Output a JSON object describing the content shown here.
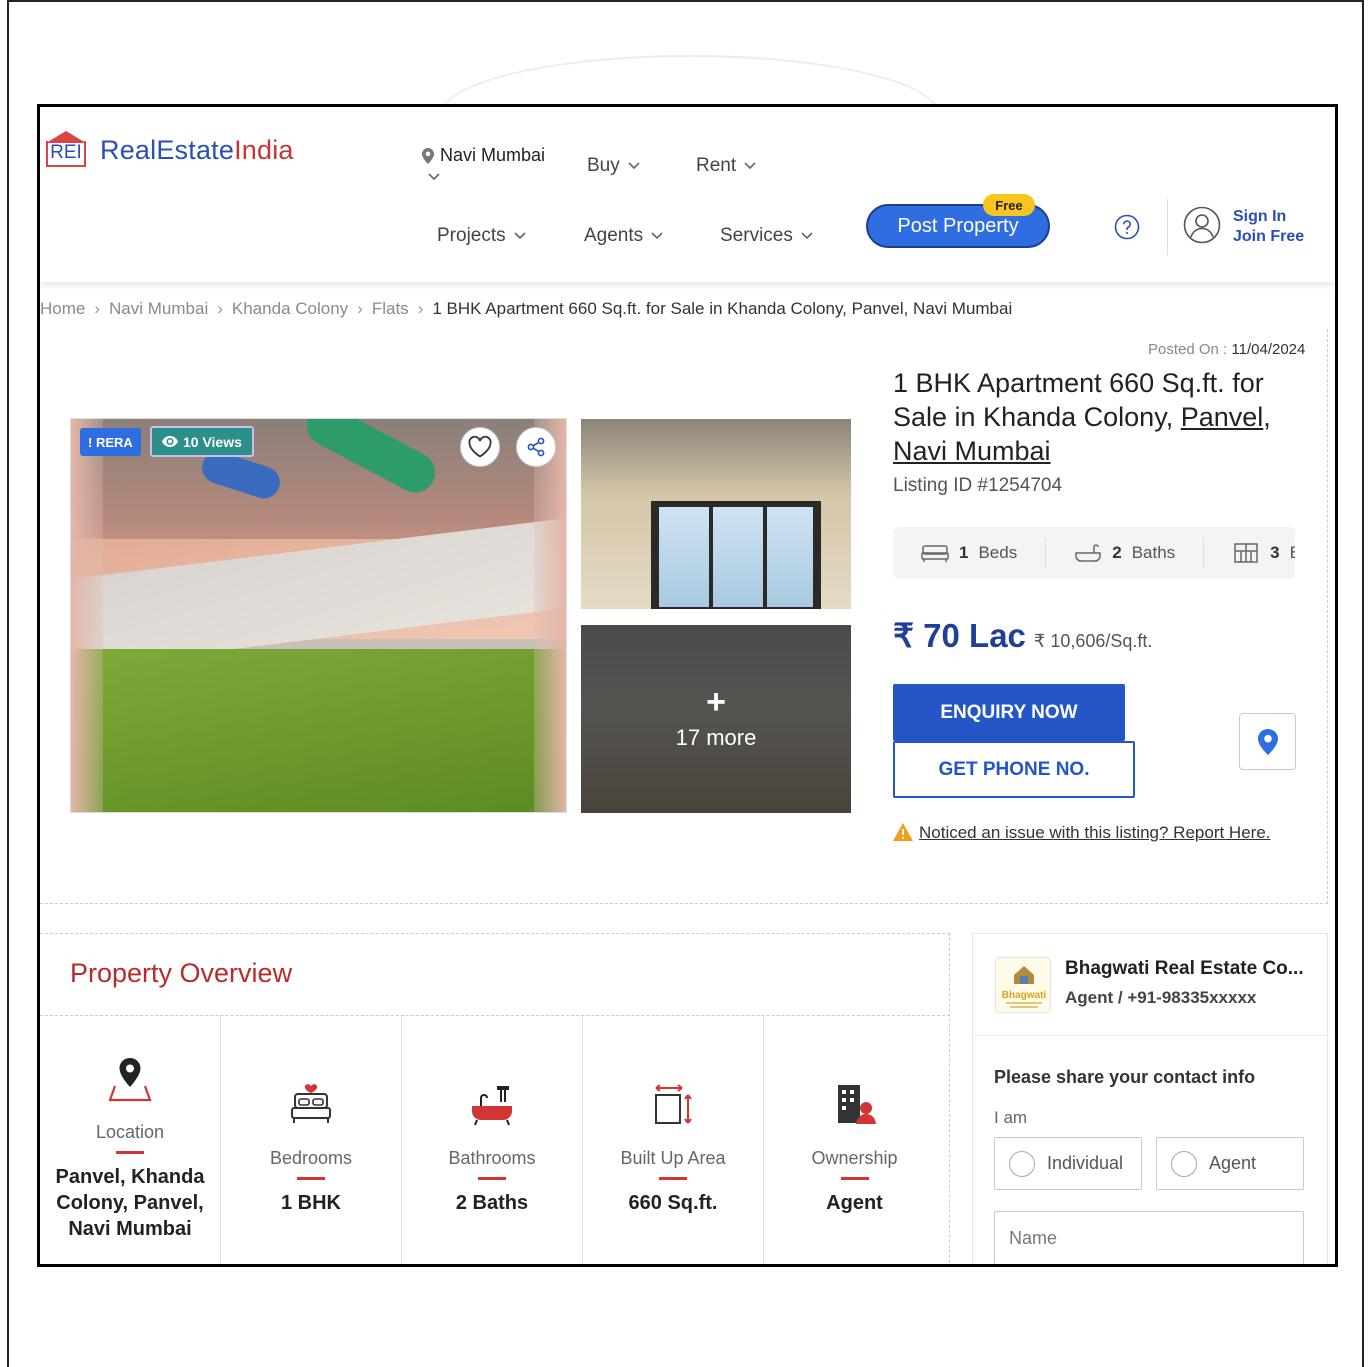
{
  "header": {
    "logo_letters": "REI",
    "logo_name_part1": "RealEstate",
    "logo_name_part2": "India",
    "location": "Navi Mumbai",
    "nav": {
      "buy": "Buy",
      "rent": "Rent",
      "projects": "Projects",
      "agents": "Agents",
      "services": "Services"
    },
    "post_property": "Post Property",
    "free_badge": "Free",
    "sign_in": "Sign In",
    "join_free": "Join Free"
  },
  "breadcrumb": {
    "items": [
      "Home",
      "Navi Mumbai",
      "Khanda Colony",
      "Flats"
    ],
    "current": "1 BHK Apartment 660 Sq.ft. for Sale in Khanda Colony, Panvel, Navi Mumbai"
  },
  "listing": {
    "posted_label": "Posted On :",
    "posted_date": "11/04/2024",
    "title_part1": "1 BHK Apartment 660 Sq.ft. for Sale in Khanda Colony, ",
    "title_link1": "Panvel",
    "title_comma": ",",
    "title_link2": "Navi Mumbai",
    "listing_id": "Listing ID #1254704",
    "rera_badge": "RERA",
    "views_badge": "10 Views",
    "more_photos": "17 more",
    "specs": [
      {
        "value": "1",
        "label": "Beds"
      },
      {
        "value": "2",
        "label": "Baths"
      },
      {
        "value": "3",
        "label": "Ba"
      }
    ],
    "price": "₹ 70 Lac",
    "price_per_sqft": "₹ 10,606/Sq.ft.",
    "enquiry_button": "ENQUIRY NOW",
    "phone_button": "GET PHONE NO.",
    "report_text": "Noticed an issue with this listing? Report Here."
  },
  "overview": {
    "title": "Property Overview",
    "items": [
      {
        "label": "Location",
        "value": "Panvel, Khanda Colony, Panvel, Navi Mumbai"
      },
      {
        "label": "Bedrooms",
        "value": "1 BHK"
      },
      {
        "label": "Bathrooms",
        "value": "2 Baths"
      },
      {
        "label": "Built Up Area",
        "value": "660 Sq.ft."
      },
      {
        "label": "Ownership",
        "value": "Agent"
      }
    ]
  },
  "agent": {
    "name": "Bhagwati Real Estate Co...",
    "sub": "Agent / +91-98335xxxxx",
    "logo_text": "Bhagwati",
    "share_label": "Please share your contact info",
    "iam_label": "I am",
    "option_individual": "Individual",
    "option_agent": "Agent",
    "name_placeholder": "Name"
  },
  "colors": {
    "brand_blue": "#2a50b3",
    "brand_red": "#c93434",
    "button_blue": "#2556c7",
    "price_blue": "#1e3f9a",
    "free_yellow": "#f7c51d"
  }
}
